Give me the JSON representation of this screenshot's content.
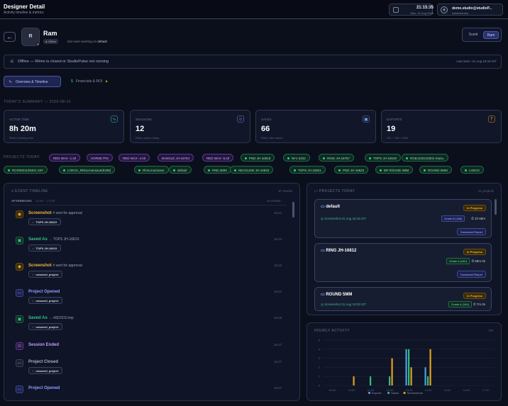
{
  "header": {
    "title": "Designer Detail",
    "subtitle": "Activity timeline & metrics",
    "clock_time": "21:15:35",
    "clock_date": "Mon, 31 Aug 2026",
    "user_email": "demo.studio@studioP...",
    "user_role": "Administrator"
  },
  "designer": {
    "initial": "R",
    "name": "Ram",
    "status": "Offline",
    "last_seen_prefix": "last seen working on",
    "last_seen_file": "default"
  },
  "toggle": {
    "left": "Sumit",
    "right": "Ram"
  },
  "banner": {
    "text": "Offline — Rhino is closed or StudioPulse not running",
    "last_seen": "Last seen: 31 Aug 19:10 IST"
  },
  "tabs": [
    {
      "label": "Overview & Timeline"
    },
    {
      "label": "Financials & ROI"
    }
  ],
  "summary_title": "TODAY'S SUMMARY — 2026-08-31",
  "cards": [
    {
      "label": "ACTIVE TIME",
      "value": "8h 20m",
      "sub": "Rhino working time",
      "icon": "activity-icon"
    },
    {
      "label": "SESSIONS",
      "value": "12",
      "sub": "Rhino opens today",
      "icon": "users-icon"
    },
    {
      "label": "SAVES",
      "value": "66",
      "sub": "Rhino files saved",
      "icon": "save-icon"
    },
    {
      "label": "EXPORTS",
      "value": "19",
      "sub": "STL / OBJ / 3DM",
      "icon": "export-icon"
    }
  ],
  "projects_label": "PROJECTS TODAY:",
  "chips_row1": [
    {
      "label": "RED WAX -1.stl",
      "kind": "r"
    },
    {
      "label": "HORSE PIN",
      "kind": "r"
    },
    {
      "label": "RED WAX -4.stl",
      "kind": "r"
    },
    {
      "label": "BANGLE JH-16754",
      "kind": "r"
    },
    {
      "label": "RED WAX -5.stl",
      "kind": "r"
    },
    {
      "label": "PND JH-16818",
      "kind": "g"
    },
    {
      "label": "NFJ-3342",
      "kind": "g"
    },
    {
      "label": "RING JH-16757",
      "kind": "g"
    },
    {
      "label": "TOPS JH-16819",
      "kind": "g"
    },
    {
      "label": "RCBJ102210001-manu.",
      "kind": "g"
    }
  ],
  "chips_row2": [
    {
      "label": "RCR0821109401-18Y",
      "kind": "g"
    },
    {
      "label": "LOECK_RhinoAutosave(9188)",
      "kind": "g"
    },
    {
      "label": "RhinoAutosave",
      "kind": "g"
    },
    {
      "label": "default",
      "kind": "g"
    },
    {
      "label": "PND 3MM",
      "kind": "g"
    },
    {
      "label": "NECKLINE JH-16820",
      "kind": "g"
    },
    {
      "label": "TOPS JH-16821",
      "kind": "g"
    },
    {
      "label": "PND JH-16822",
      "kind": "g"
    },
    {
      "label": "BR ROUND 4MM",
      "kind": "g"
    },
    {
      "label": "ROUND 5MM",
      "kind": "g"
    },
    {
      "label": "LOECK",
      "kind": "g"
    }
  ],
  "timeline": {
    "title": "EVENT TIMELINE",
    "count": "67 events",
    "group_label": "AFTERNOON",
    "group_range": "12:00 – 17:00",
    "group_count": "34 events",
    "events": [
      {
        "title": "Screenshot",
        "meta": "# sent for approval",
        "tag": "TOPS JH-16819",
        "time": "16:21",
        "kind": "shot"
      },
      {
        "title": "Saved As",
        "meta": "→ TOPS JH-16819",
        "tag": "TOPS JH-16819",
        "time": "16:23",
        "kind": "save"
      },
      {
        "title": "Screenshot",
        "meta": "# sent for approval",
        "tag": "unsaved_project",
        "time": "16:23",
        "kind": "shot"
      },
      {
        "title": "Project Opened",
        "meta": "",
        "tag": "unsaved_project",
        "time": "16:24",
        "kind": "open"
      },
      {
        "title": "Saved As",
        "meta": "→ rh$15C6.tmp",
        "tag": "unsaved_project",
        "time": "16:26",
        "kind": "save"
      },
      {
        "title": "Session Ended",
        "meta": "",
        "tag": "",
        "time": "16:27",
        "kind": "end"
      },
      {
        "title": "Project Closed",
        "meta": "",
        "tag": "unsaved_project",
        "time": "16:27",
        "kind": "close"
      },
      {
        "title": "Project Opened",
        "meta": "",
        "tag": "",
        "time": "16:27",
        "kind": "open"
      }
    ]
  },
  "projects_panel": {
    "title": "PROJECTS TODAY",
    "count": "31 projects",
    "items": [
      {
        "name": "default",
        "status": "In Progress",
        "detail": "Screenshot 31 Aug 18:16 IST",
        "grade": "Grade B (186)",
        "duration": "1h 59m",
        "button": "Download Report"
      },
      {
        "name": "RING JH-16812",
        "status": "In Progress",
        "detail": "",
        "grade": "Grade A (430)",
        "duration": "59m 0s",
        "button": "Download Report"
      },
      {
        "name": "ROUND 5MM",
        "status": "In Progress",
        "detail": "Screenshot 31 Aug 19:03 IST",
        "grade": "Grade A (169)",
        "duration": "7m 0s",
        "button": ""
      }
    ]
  },
  "hourly": {
    "title": "HOURLY ACTIVITY",
    "tz": "IST"
  },
  "chart_data": {
    "type": "bar",
    "ylim": [
      0,
      5
    ],
    "yticks": [
      "0",
      "1",
      "2",
      "3",
      "4",
      "5"
    ],
    "categories": [
      "09:00",
      "10:00",
      "11:00",
      "12:00",
      "13:00",
      "14:00",
      "15:00",
      "16:00",
      "17:00"
    ],
    "series": [
      {
        "name": "Exports",
        "color": "#4aa3e0",
        "values": [
          0,
          0,
          0,
          0,
          4,
          2,
          0,
          0,
          0
        ]
      },
      {
        "name": "Saves",
        "color": "#2fbf7f",
        "values": [
          0,
          0,
          1,
          1,
          4,
          1,
          0,
          0,
          0
        ]
      },
      {
        "name": "Screenshots",
        "color": "#e0a21e",
        "values": [
          0,
          1,
          0,
          3,
          2,
          4,
          0,
          0,
          0
        ]
      }
    ]
  }
}
